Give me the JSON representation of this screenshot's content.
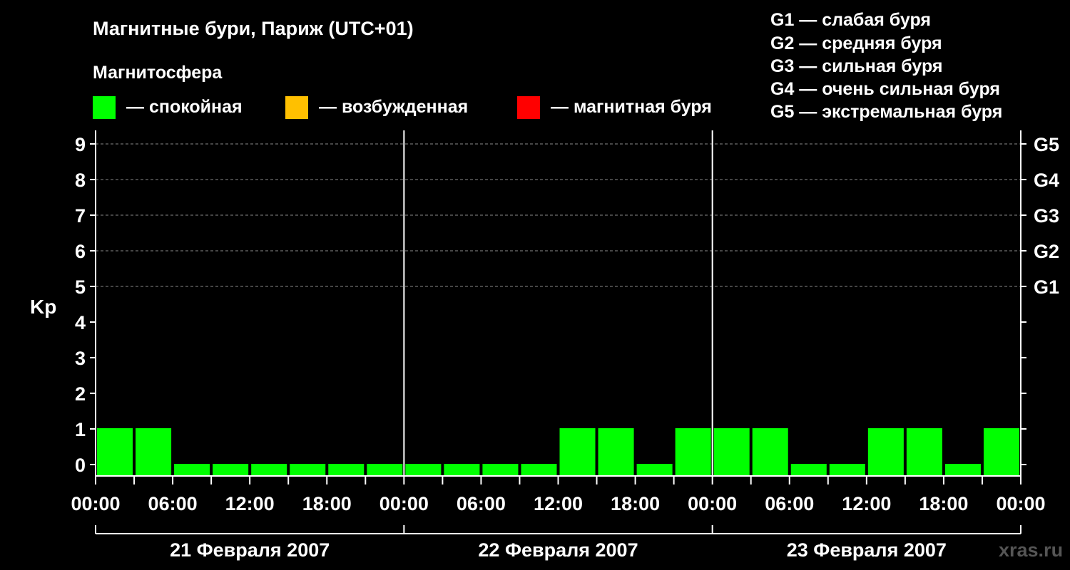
{
  "chart_data": {
    "type": "bar",
    "title": "Магнитные бури, Париж (UTC+01)",
    "legend_title": "Магнитосфера",
    "legend": [
      {
        "color": "#00ff00",
        "label": "— спокойная"
      },
      {
        "color": "#ffc000",
        "label": "— возбужденная"
      },
      {
        "color": "#ff0000",
        "label": "— магнитная буря"
      }
    ],
    "storm_scale": [
      "G1 — слабая буря",
      "G2 — средняя буря",
      "G3 — сильная буря",
      "G4 — очень сильная буря",
      "G5 — экстремальная буря"
    ],
    "ylabel": "Kp",
    "ylim": [
      0,
      9
    ],
    "y_ticks": [
      "0",
      "1",
      "2",
      "3",
      "4",
      "5",
      "6",
      "7",
      "8",
      "9"
    ],
    "right_ticks": [
      {
        "kp": 5,
        "label": "G1"
      },
      {
        "kp": 6,
        "label": "G2"
      },
      {
        "kp": 7,
        "label": "G3"
      },
      {
        "kp": 8,
        "label": "G4"
      },
      {
        "kp": 9,
        "label": "G5"
      }
    ],
    "x_tick_labels": [
      "00:00",
      "06:00",
      "12:00",
      "18:00",
      "00:00",
      "06:00",
      "12:00",
      "18:00",
      "00:00",
      "06:00",
      "12:00",
      "18:00",
      "00:00"
    ],
    "days": [
      "21 Февраля 2007",
      "22 Февраля 2007",
      "23 Февраля 2007"
    ],
    "interval_hours": 3,
    "series": [
      {
        "values": [
          1,
          1,
          0,
          0,
          0,
          0,
          0,
          0,
          0,
          0,
          0,
          0,
          1,
          1,
          0,
          1,
          1,
          1,
          0,
          0,
          1,
          1,
          0,
          1
        ],
        "colors": [
          "#00ff00",
          "#00ff00",
          "#00ff00",
          "#00ff00",
          "#00ff00",
          "#00ff00",
          "#00ff00",
          "#00ff00",
          "#00ff00",
          "#00ff00",
          "#00ff00",
          "#00ff00",
          "#00ff00",
          "#00ff00",
          "#00ff00",
          "#00ff00",
          "#00ff00",
          "#00ff00",
          "#00ff00",
          "#00ff00",
          "#00ff00",
          "#00ff00",
          "#00ff00",
          "#00ff00"
        ]
      }
    ],
    "grid": "dashed lines at each Kp level from 5 to 9",
    "watermark": "xras.ru"
  }
}
